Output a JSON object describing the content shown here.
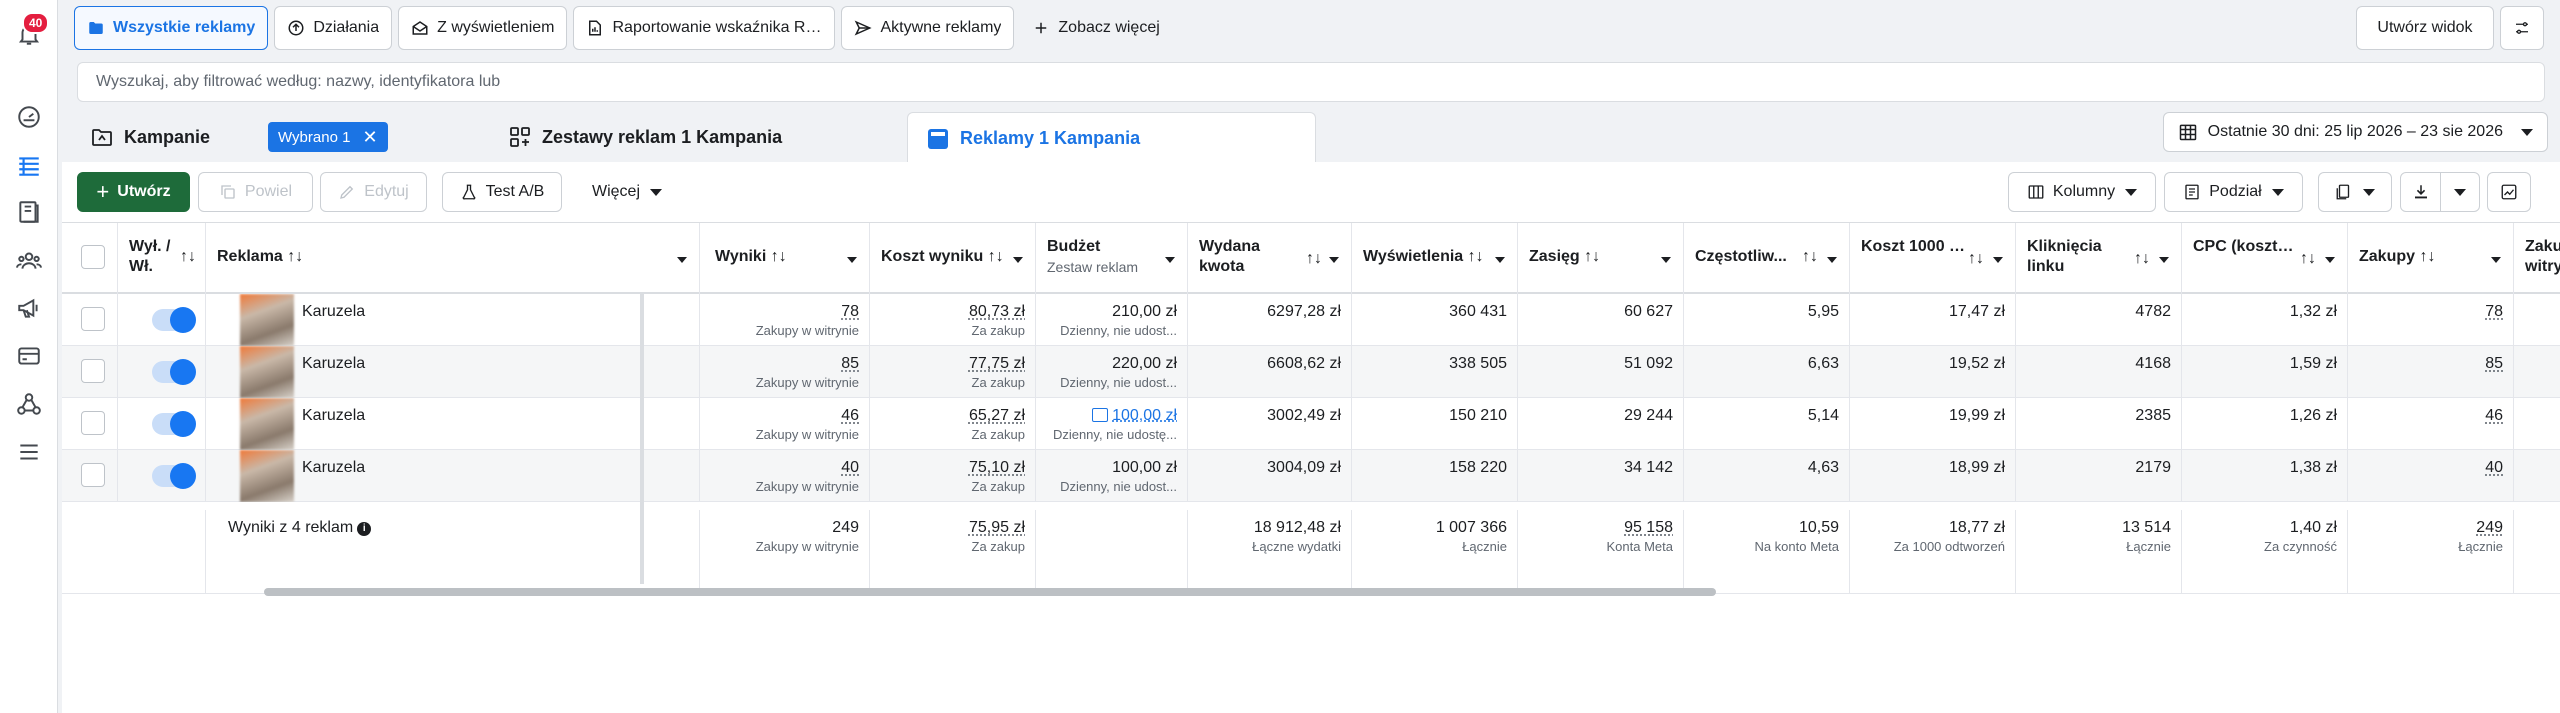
{
  "notifications": {
    "count": "40"
  },
  "icons": {
    "notifications": "bell-icon",
    "dashboard": "gauge-icon",
    "manager": "table-icon",
    "pages": "book-icon",
    "audiences": "people-icon",
    "campaigns": "megaphone-icon",
    "billing": "card-icon",
    "network": "network-icon",
    "menu": "menu-icon"
  },
  "tabs": [
    {
      "label": "Wszystkie reklamy",
      "icon": "folder-icon"
    },
    {
      "label": "Działania",
      "icon": "activity-icon"
    },
    {
      "label": "Z wyświetleniem",
      "icon": "mail-open-icon"
    },
    {
      "label": "Raportowanie wskaźnika RO...",
      "icon": "report-icon"
    },
    {
      "label": "Aktywne reklamy",
      "icon": "send-icon"
    },
    {
      "label": "Zobacz więcej",
      "icon": "plus-icon"
    }
  ],
  "create_view": "Utwórz widok",
  "search": {
    "placeholder": "Wyszukaj, aby filtrować według: nazwy, identyfikatora lub"
  },
  "levels": {
    "campaigns": "Kampanie",
    "selected_chip": "Wybrano 1",
    "adsets": "Zestawy reklam 1 Kampania",
    "ads": "Reklamy 1 Kampania"
  },
  "date_range": "Ostatnie 30 dni: 25 lip 2026 – 23 sie 2026",
  "toolbar": {
    "create": "Utwórz",
    "duplicate": "Powiel",
    "edit": "Edytuj",
    "ab_test": "Test A/B",
    "more": "Więcej",
    "columns": "Kolumny",
    "breakdown": "Podział"
  },
  "columns": {
    "toggle": "Wył. / Wł.",
    "ad": "Reklama",
    "results": "Wyniki",
    "cost_per_result": "Koszt wyniku",
    "budget": "Budżet",
    "budget_sub": "Zestaw reklam",
    "spent": "Wydana kwota",
    "impressions": "Wyświetlenia",
    "reach": "Zasięg",
    "frequency": "Częstotliw...",
    "cpm": "Koszt 1000 wyświetleń...",
    "link_clicks": "Kliknięcia linku",
    "cpc": "CPC (koszt kliknięcia...",
    "purchases": "Zakupy",
    "web_purchases": "Zakupy w witrynie"
  },
  "rows": [
    {
      "name": "Karuzela",
      "results": "78",
      "results_sub": "Zakupy w witrynie",
      "cpr": "80,73 zł",
      "cpr_sub": "Za zakup",
      "budget": "210,00 zł",
      "budget_sub": "Dzienny, nie udost...",
      "spent": "6297,28 zł",
      "impressions": "360 431",
      "reach": "60 627",
      "frequency": "5,95",
      "cpm": "17,47 zł",
      "clicks": "4782",
      "cpc": "1,32 zł",
      "purchases": "78"
    },
    {
      "name": "Karuzela",
      "results": "85",
      "results_sub": "Zakupy w witrynie",
      "cpr": "77,75 zł",
      "cpr_sub": "Za zakup",
      "budget": "220,00 zł",
      "budget_sub": "Dzienny, nie udost...",
      "spent": "6608,62 zł",
      "impressions": "338 505",
      "reach": "51 092",
      "frequency": "6,63",
      "cpm": "19,52 zł",
      "clicks": "4168",
      "cpc": "1,59 zł",
      "purchases": "85"
    },
    {
      "name": "Karuzela",
      "results": "46",
      "results_sub": "Zakupy w witrynie",
      "cpr": "65,27 zł",
      "cpr_sub": "Za zakup",
      "budget": "100,00 zł",
      "budget_sub": "Dzienny, nie udostę...",
      "spent": "3002,49 zł",
      "impressions": "150 210",
      "reach": "29 244",
      "frequency": "5,14",
      "cpm": "19,99 zł",
      "clicks": "2385",
      "cpc": "1,26 zł",
      "purchases": "46"
    },
    {
      "name": "Karuzela",
      "results": "40",
      "results_sub": "Zakupy w witrynie",
      "cpr": "75,10 zł",
      "cpr_sub": "Za zakup",
      "budget": "100,00 zł",
      "budget_sub": "Dzienny, nie udost...",
      "spent": "3004,09 zł",
      "impressions": "158 220",
      "reach": "34 142",
      "frequency": "4,63",
      "cpm": "18,99 zł",
      "clicks": "2179",
      "cpc": "1,38 zł",
      "purchases": "40"
    }
  ],
  "summary": {
    "label": "Wyniki z 4 reklam",
    "results": "249",
    "results_sub": "Zakupy w witrynie",
    "cpr": "75,95 zł",
    "cpr_sub": "Za zakup",
    "spent": "18 912,48 zł",
    "spent_sub": "Łączne wydatki",
    "impressions": "1 007 366",
    "impressions_sub": "Łącznie",
    "reach": "95 158",
    "reach_sub": "Konta Meta",
    "frequency": "10,59",
    "frequency_sub": "Na konto Meta",
    "cpm": "18,77 zł",
    "cpm_sub": "Za 1000 odtworzeń",
    "clicks": "13 514",
    "clicks_sub": "Łącznie",
    "cpc": "1,40 zł",
    "cpc_sub": "Za czynność",
    "purchases": "249",
    "purchases_sub": "Łącznie"
  }
}
